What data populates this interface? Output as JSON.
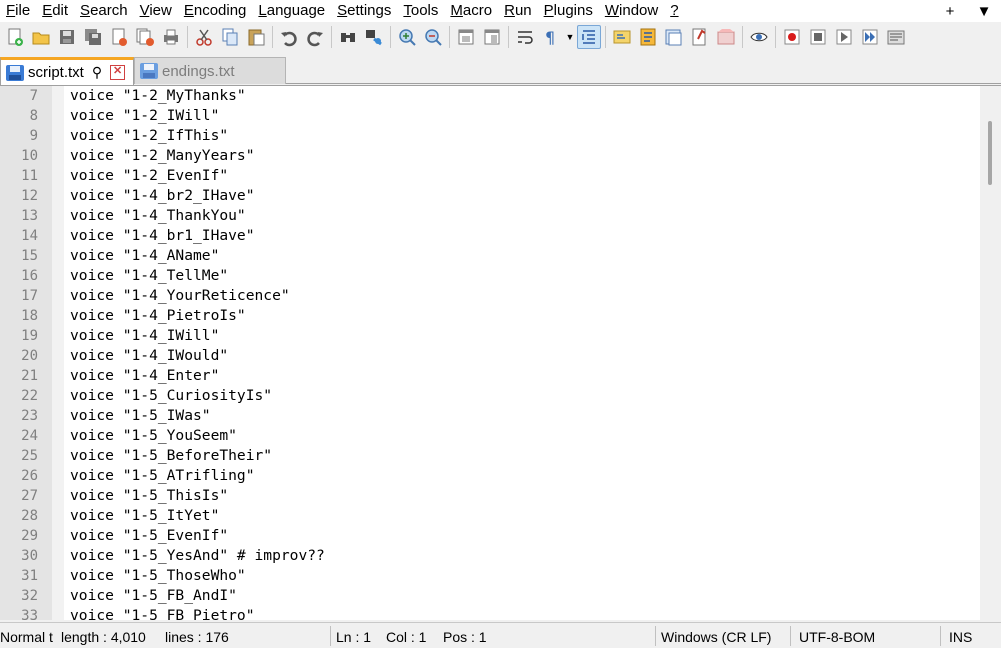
{
  "menu": {
    "items": [
      {
        "label": "File",
        "ul": "F",
        "rest": "ile"
      },
      {
        "label": "Edit",
        "ul": "E",
        "rest": "dit"
      },
      {
        "label": "Search",
        "ul": "S",
        "rest": "earch"
      },
      {
        "label": "View",
        "ul": "V",
        "rest": "iew"
      },
      {
        "label": "Encoding",
        "ul": "E",
        "rest": "ncoding"
      },
      {
        "label": "Language",
        "ul": "L",
        "rest": "anguage"
      },
      {
        "label": "Settings",
        "ul": "S",
        "rest": "ettings"
      },
      {
        "label": "Tools",
        "ul": "T",
        "rest": "ools"
      },
      {
        "label": "Macro",
        "ul": "M",
        "rest": "acro"
      },
      {
        "label": "Run",
        "ul": "R",
        "rest": "un"
      },
      {
        "label": "Plugins",
        "ul": "P",
        "rest": "lugins"
      },
      {
        "label": "Window",
        "ul": "W",
        "rest": "indow"
      },
      {
        "label": "?",
        "ul": "?",
        "rest": ""
      }
    ],
    "plus_glyph": "+",
    "dropdown_glyph": "▼"
  },
  "toolbar": {
    "icons": [
      "new-file-icon",
      "open-file-icon",
      "save-icon",
      "save-all-icon",
      "close-icon",
      "close-all-icon",
      "print-icon",
      "cut-icon",
      "copy-icon",
      "paste-icon",
      "undo-icon",
      "redo-icon",
      "find-icon",
      "replace-icon",
      "zoom-in-icon",
      "zoom-out-icon",
      "sync-vertical-icon",
      "sync-horizontal-icon",
      "word-wrap-icon",
      "show-all-chars-icon",
      "indent-guide-icon",
      "doc-map-icon",
      "function-list-icon",
      "folder-workspace-icon",
      "monitoring-icon",
      "record-macro-icon",
      "stop-record-icon",
      "playback-macro-icon",
      "run-macro-multiple-icon",
      "save-macro-icon"
    ]
  },
  "tabs": [
    {
      "label": "script.txt",
      "active": true,
      "pin": "📌",
      "close": "✕"
    },
    {
      "label": "endings.txt",
      "active": false
    }
  ],
  "editor": {
    "lines": [
      {
        "num": "7",
        "text": "voice \"1-2_MyThanks\""
      },
      {
        "num": "8",
        "text": "voice \"1-2_IWill\""
      },
      {
        "num": "9",
        "text": "voice \"1-2_IfThis\""
      },
      {
        "num": "10",
        "text": "voice \"1-2_ManyYears\""
      },
      {
        "num": "11",
        "text": "voice \"1-2_EvenIf\""
      },
      {
        "num": "12",
        "text": "voice \"1-4_br2_IHave\""
      },
      {
        "num": "13",
        "text": "voice \"1-4_ThankYou\""
      },
      {
        "num": "14",
        "text": "voice \"1-4_br1_IHave\""
      },
      {
        "num": "15",
        "text": "voice \"1-4_AName\""
      },
      {
        "num": "16",
        "text": "voice \"1-4_TellMe\""
      },
      {
        "num": "17",
        "text": "voice \"1-4_YourReticence\""
      },
      {
        "num": "18",
        "text": "voice \"1-4_PietroIs\""
      },
      {
        "num": "19",
        "text": "voice \"1-4_IWill\""
      },
      {
        "num": "20",
        "text": "voice \"1-4_IWould\""
      },
      {
        "num": "21",
        "text": "voice \"1-4_Enter\""
      },
      {
        "num": "22",
        "text": "voice \"1-5_CuriosityIs\""
      },
      {
        "num": "23",
        "text": "voice \"1-5_IWas\""
      },
      {
        "num": "24",
        "text": "voice \"1-5_YouSeem\""
      },
      {
        "num": "25",
        "text": "voice \"1-5_BeforeTheir\""
      },
      {
        "num": "26",
        "text": "voice \"1-5_ATrifling\""
      },
      {
        "num": "27",
        "text": "voice \"1-5_ThisIs\""
      },
      {
        "num": "28",
        "text": "voice \"1-5_ItYet\""
      },
      {
        "num": "29",
        "text": "voice \"1-5_EvenIf\""
      },
      {
        "num": "30",
        "text": "voice \"1-5_YesAnd\" # improv??"
      },
      {
        "num": "31",
        "text": "voice \"1-5_ThoseWho\""
      },
      {
        "num": "32",
        "text": "voice \"1-5_FB_AndI\""
      },
      {
        "num": "33",
        "text": "voice \"1-5_FB_Pietro\""
      }
    ]
  },
  "status": {
    "filetype": "Normal t",
    "length": "length : 4,010",
    "lines": "lines : 176",
    "ln": "Ln : 1",
    "col": "Col : 1",
    "pos": "Pos : 1",
    "eol": "Windows (CR LF)",
    "encoding": "UTF-8-BOM",
    "mode": "INS"
  },
  "colors": {
    "active_tab_accent": "#f5a623",
    "gutter_bg": "#e4e4e4",
    "line_number": "#808080",
    "tab_close": "#d04040"
  }
}
